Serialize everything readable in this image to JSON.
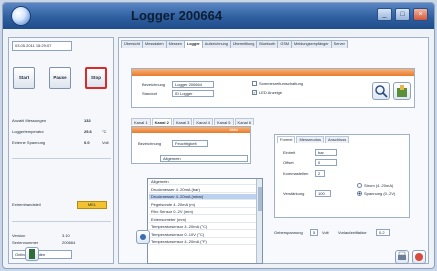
{
  "window": {
    "title": "Logger 200664"
  },
  "left": {
    "date": "03.05.2011 15:29:07",
    "buttons": {
      "start": "Start",
      "pause": "Pause",
      "stop": "Stop"
    },
    "stats": [
      {
        "label": "Anzahl Messungen",
        "value": "132",
        "unit": ""
      },
      {
        "label": "Loggertemperatur",
        "value": "25.6",
        "unit": "°C"
      },
      {
        "label": "Externe Spannung",
        "value": "0.0",
        "unit": "Volt"
      }
    ],
    "status": {
      "label": "Extremhandsteil",
      "value": "MEL",
      "color": "#f2c230"
    },
    "info": [
      {
        "label": "Version",
        "value": "3.10"
      },
      {
        "label": "Seriennummer",
        "value": "200664"
      }
    ],
    "online": "Online verbinden"
  },
  "main": {
    "tabs": [
      "Übersicht",
      "Messdaten",
      "Messen",
      "Logger",
      "Aufzeichnung",
      "Übermittlung",
      "Bluetooth",
      "GSM",
      "Meldungsempfänger",
      "Server"
    ],
    "active_tab": "Logger",
    "header": {
      "name_label": "Bezeichnung",
      "name_value": "Logger 200664",
      "location_label": "Standort",
      "location_value": "ID Logger",
      "check1": "Sommerzeitumschaltung",
      "check2": "LED Anzeige"
    },
    "kanal_tabs": [
      "Kanal 1",
      "Kanal 2",
      "Kanal 3",
      "Kanal 4",
      "Kanal 5",
      "Kanal 6"
    ],
    "kanal_active": "Kanal 2",
    "channel": {
      "badge": "Aktiv",
      "label": "Bezeichnung",
      "value": "Feuchtigkeit"
    },
    "dropdown_items": [
      "Allgemein",
      "Druckmesser 4..20mA (bar)",
      "Druckmesser 4..20mA (mbar)",
      "Pegelsonde 4..20mA (m)",
      "Rho Sensor 0..2V (mm)",
      "Extensometer (mm)",
      "Temperatursensor 4..20mA (°C)",
      "Temperatursensor 0..10V (°C)",
      "Temperatursensor 4..20mA (°F)"
    ],
    "dropdown_selected": "Druckmesser 4..20mA (mbar)",
    "right_tabs": [
      "Formel",
      "Messmodus",
      "Anschluss"
    ],
    "right_fields": [
      {
        "label": "Einheit",
        "value": "bar"
      },
      {
        "label": "Offset",
        "value": "0"
      },
      {
        "label": "Kommastellen",
        "value": "2"
      }
    ],
    "right_radio": [
      {
        "label": "Strom (4..20mA)",
        "on": false
      },
      {
        "label": "Spannung (0..2V)",
        "on": true
      }
    ],
    "verstaerkung": {
      "label": "Verstärkung",
      "value": "100"
    },
    "bottom": {
      "gebervoltage_label": "Geberspannung",
      "gebervoltage_value": "5",
      "unit": "Volt",
      "vorlaufzeit_label": "Vorlaufzeitfaktor",
      "vorlaufzeit_value": "0.2"
    }
  }
}
